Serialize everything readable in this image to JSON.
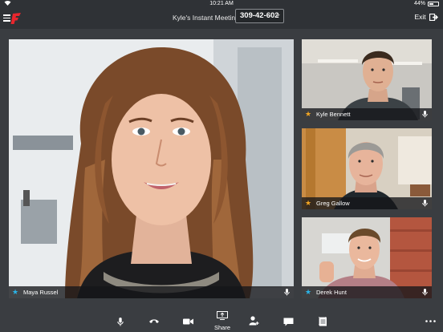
{
  "status_bar": {
    "time": "10:21 AM",
    "battery_percent": "44%",
    "battery_level": 0.44
  },
  "header": {
    "meeting_title": "Kyle's Instant Meeting",
    "meeting_id": "309-42-602",
    "exit_label": "Exit"
  },
  "participants": {
    "main": {
      "name": "Maya Russel",
      "starred": true,
      "star_color": "#2ab4e8"
    },
    "side": [
      {
        "name": "Kyle Bennett",
        "starred": true,
        "star_color": "#f3a623"
      },
      {
        "name": "Greg Gallow",
        "starred": true,
        "star_color": "#f3a623"
      },
      {
        "name": "Derek Hunt",
        "starred": true,
        "star_color": "#2ab4e8"
      }
    ]
  },
  "toolbar": {
    "share_label": "Share",
    "buttons": [
      "microphone-icon",
      "phone-icon",
      "video-camera-icon",
      "share-screen-icon",
      "add-participant-icon",
      "chat-icon",
      "notes-icon",
      "more-icon"
    ]
  },
  "colors": {
    "background": "#3a3d41",
    "bar": "#2f3236",
    "logo_red": "#e8262d",
    "star_gold": "#f3a623",
    "star_blue": "#2ab4e8"
  }
}
